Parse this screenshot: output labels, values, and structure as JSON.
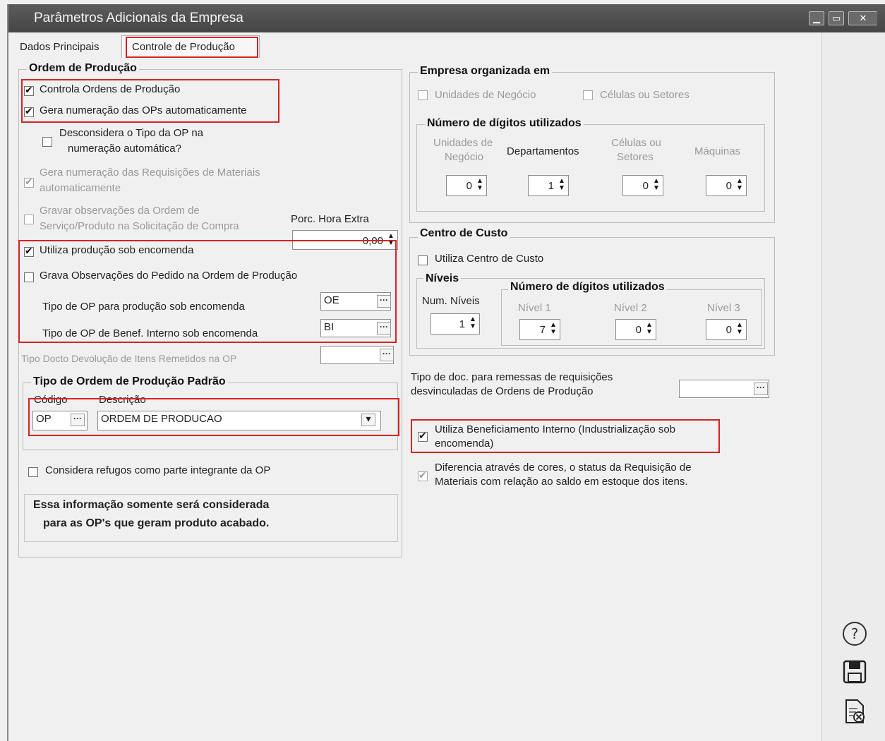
{
  "window": {
    "title": "Parâmetros Adicionais da Empresa"
  },
  "tabs": [
    {
      "label": "Dados Principais"
    },
    {
      "label": "Controle de Produção"
    }
  ],
  "ordem_producao": {
    "legend": "Ordem de Produção",
    "controla": {
      "label": "Controla Ordens de Produção",
      "checked": true
    },
    "gera_num": {
      "label": "Gera numeração das OPs automaticamente",
      "checked": true
    },
    "desconsidera": {
      "label1": "Desconsidera o Tipo da OP na",
      "label2": "numeração automática?",
      "checked": false
    },
    "gera_req": {
      "label1": "Gera numeração das Requisições de Materiais",
      "label2": "automaticamente",
      "checked": true
    },
    "gravar_obs": {
      "label1": "Gravar observações da Ordem de",
      "label2": "Serviço/Produto na Solicitação de Compra",
      "checked": false
    },
    "porc_hora_extra": {
      "label": "Porc. Hora Extra",
      "value": "0,00"
    },
    "utiliza_encomenda": {
      "label": "Utiliza produção sob encomenda",
      "checked": true
    },
    "grava_obs_pedido": {
      "label": "Grava Observações do Pedido na Ordem de Produção",
      "checked": false
    },
    "tipo_op_encomenda": {
      "label": "Tipo de OP para produção sob encomenda",
      "value": "OE"
    },
    "tipo_op_benef": {
      "label": "Tipo de OP de Benef. Interno sob encomenda",
      "value": "BI"
    },
    "tipo_docto_dev": {
      "label": "Tipo Docto Devolução de Itens Remetidos na OP",
      "value": ""
    }
  },
  "tipo_padrao": {
    "legend": "Tipo de Ordem de Produção Padrão",
    "codigo_label": "Código",
    "descricao_label": "Descrição",
    "codigo": "OP",
    "descricao": "ORDEM DE PRODUCAO"
  },
  "considera_refugos": {
    "label": "Considera refugos como parte integrante da OP",
    "checked": false
  },
  "info_note": {
    "line1": "Essa informação somente será considerada",
    "line2": "para as OP's que geram produto acabado."
  },
  "empresa_org": {
    "legend": "Empresa organizada em",
    "unidades": {
      "label": "Unidades de Negócio",
      "checked": false
    },
    "celulas": {
      "label": "Células ou Setores",
      "checked": false
    },
    "digitos": {
      "legend": "Número de dígitos utilizados",
      "cols": [
        {
          "label1": "Unidades de",
          "label2": "Negócio",
          "value": "0",
          "enabled": false
        },
        {
          "label1": "Departamentos",
          "label2": "",
          "value": "1",
          "enabled": true
        },
        {
          "label1": "Células ou",
          "label2": "Setores",
          "value": "0",
          "enabled": false
        },
        {
          "label1": "Máquinas",
          "label2": "",
          "value": "0",
          "enabled": false
        }
      ]
    }
  },
  "centro_custo": {
    "legend": "Centro de Custo",
    "utiliza": {
      "label": "Utiliza Centro de Custo",
      "checked": false
    },
    "niveis_legend": "Níveis",
    "num_niveis_label": "Num. Níveis",
    "num_niveis": "1",
    "digitos_legend": "Número de dígitos utilizados",
    "nivel1": {
      "label": "Nível 1",
      "value": "7"
    },
    "nivel2": {
      "label": "Nível 2",
      "value": "0"
    },
    "nivel3": {
      "label": "Nível 3",
      "value": "0"
    }
  },
  "tipo_doc_remessas": {
    "label1": "Tipo de doc. para remessas de requisições",
    "label2": "desvinculadas de Ordens de Produção",
    "value": ""
  },
  "utiliza_benef": {
    "label1": "Utiliza Beneficiamento Interno (Industrialização sob",
    "label2": "encomenda)",
    "checked": true
  },
  "diferencia_cores": {
    "label1": "Diferencia através de cores, o status da Requisição de",
    "label2": "Materiais com relação ao saldo em estoque dos itens.",
    "checked": true
  },
  "sidebar_icons": [
    "help-icon",
    "save-icon",
    "cancel-document-icon"
  ],
  "colors": {
    "titlebar": "#4f4f4f",
    "highlight": "#d62323",
    "background": "#f0f0f0"
  }
}
